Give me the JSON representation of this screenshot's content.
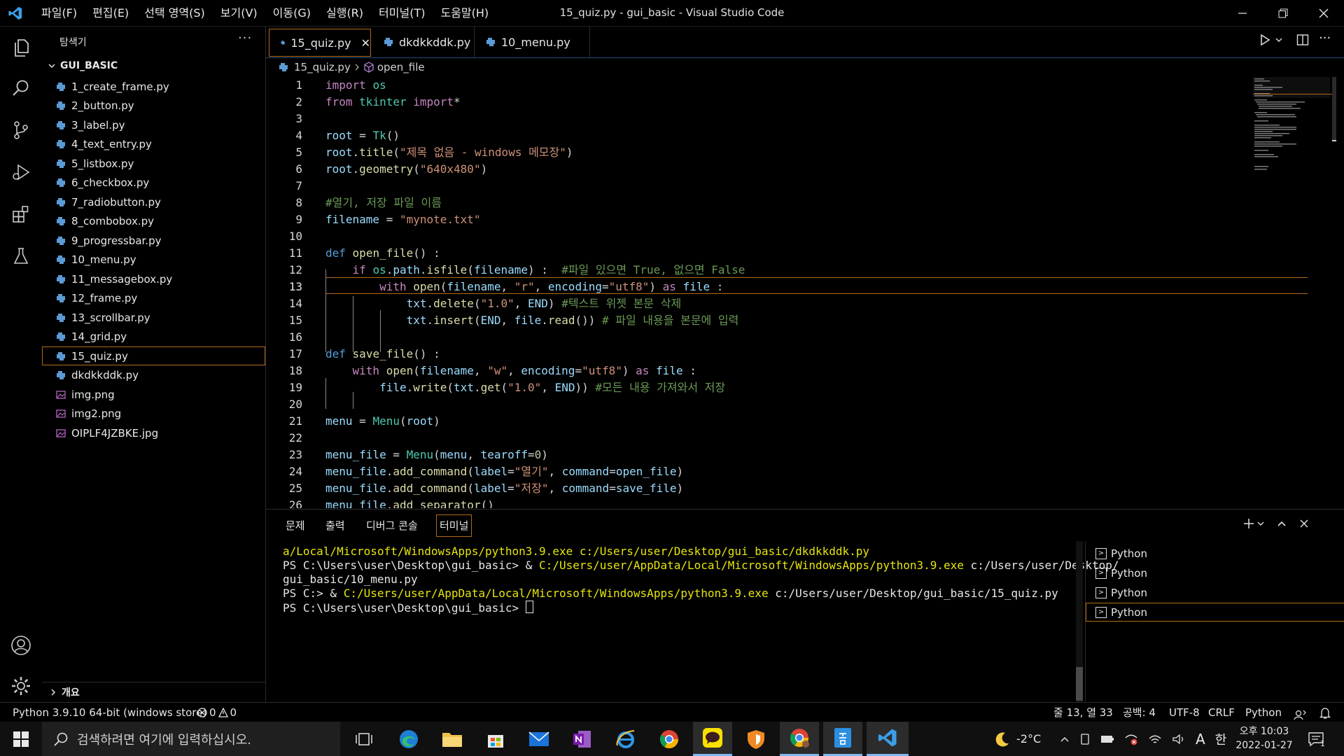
{
  "window": {
    "title": "15_quiz.py - gui_basic - Visual Studio Code",
    "menu": [
      "파일(F)",
      "편집(E)",
      "선택 영역(S)",
      "보기(V)",
      "이동(G)",
      "실행(R)",
      "터미널(T)",
      "도움말(H)"
    ],
    "controls": {
      "minimize": "—",
      "restore": "❐",
      "close": "✕"
    }
  },
  "sidebar": {
    "title": "탐색기",
    "more": "···",
    "folder": "GUI_BASIC",
    "files": [
      {
        "name": "1_create_frame.py",
        "type": "py"
      },
      {
        "name": "2_button.py",
        "type": "py"
      },
      {
        "name": "3_label.py",
        "type": "py"
      },
      {
        "name": "4_text_entry.py",
        "type": "py"
      },
      {
        "name": "5_listbox.py",
        "type": "py"
      },
      {
        "name": "6_checkbox.py",
        "type": "py"
      },
      {
        "name": "7_radiobutton.py",
        "type": "py"
      },
      {
        "name": "8_combobox.py",
        "type": "py"
      },
      {
        "name": "9_progressbar.py",
        "type": "py"
      },
      {
        "name": "10_menu.py",
        "type": "py"
      },
      {
        "name": "11_messagebox.py",
        "type": "py"
      },
      {
        "name": "12_frame.py",
        "type": "py"
      },
      {
        "name": "13_scrollbar.py",
        "type": "py"
      },
      {
        "name": "14_grid.py",
        "type": "py"
      },
      {
        "name": "15_quiz.py",
        "type": "py",
        "active": true
      },
      {
        "name": "dkdkkddk.py",
        "type": "py"
      },
      {
        "name": "img.png",
        "type": "img"
      },
      {
        "name": "img2.png",
        "type": "img"
      },
      {
        "name": "OIPLF4JZBKE.jpg",
        "type": "img"
      }
    ],
    "outline": "개요"
  },
  "tabs": [
    {
      "label": "15_quiz.py",
      "active": true,
      "close": "✕"
    },
    {
      "label": "dkdkkddk.py"
    },
    {
      "label": "10_menu.py"
    }
  ],
  "breadcrumb": {
    "file": "15_quiz.py",
    "symbol": "open_file"
  },
  "editor": {
    "line_numbers": [
      "1",
      "2",
      "3",
      "4",
      "5",
      "6",
      "7",
      "8",
      "9",
      "10",
      "11",
      "12",
      "13",
      "14",
      "15",
      "16",
      "17",
      "18",
      "19",
      "20",
      "21",
      "22",
      "23",
      "24",
      "25",
      "26"
    ],
    "current_line": 13
  },
  "panel": {
    "tabs": [
      "문제",
      "출력",
      "디버그 콘솔",
      "터미널"
    ],
    "active_tab": "터미널",
    "terminal": {
      "l1": "a/Local/Microsoft/WindowsApps/python3.9.exe c:/Users/user/Desktop/gui_basic/dkdkkddk.py",
      "l2a": "PS C:\\Users\\user\\Desktop\\gui_basic> & ",
      "l2b": "C:/Users/user/AppData/Local/Microsoft/WindowsApps/python3.9.exe",
      "l2c": " c:/Users/user/Desktop/",
      "l3": "gui_basic/10_menu.py",
      "l4a": "PS C:> & ",
      "l4b": "C:/Users/user/AppData/Local/Microsoft/WindowsApps/python3.9.exe",
      "l4c": " c:/Users/user/Desktop/gui_basic/15_quiz.py",
      "l5": "PS C:\\Users\\user\\Desktop\\gui_basic> "
    },
    "terminals": [
      "Python",
      "Python",
      "Python",
      "Python"
    ]
  },
  "status": {
    "interpreter": "Python 3.9.10 64-bit (windows store)",
    "errors": "0",
    "warnings": "0",
    "position": "줄 13, 열 33",
    "spaces": "공백: 4",
    "encoding": "UTF-8",
    "eol": "CRLF",
    "language": "Python"
  },
  "taskbar": {
    "search_placeholder": "검색하려면 여기에 입력하십시오.",
    "weather": "-2°C",
    "ime": "한",
    "ime_mode": "A",
    "time": "오후 10:03",
    "date": "2022-01-27",
    "notifications": "1"
  },
  "colors": {
    "accent_border": "#b26a1a",
    "tab_underline": "#1f4b7c",
    "vscode_blue": "#3c9ee8"
  }
}
